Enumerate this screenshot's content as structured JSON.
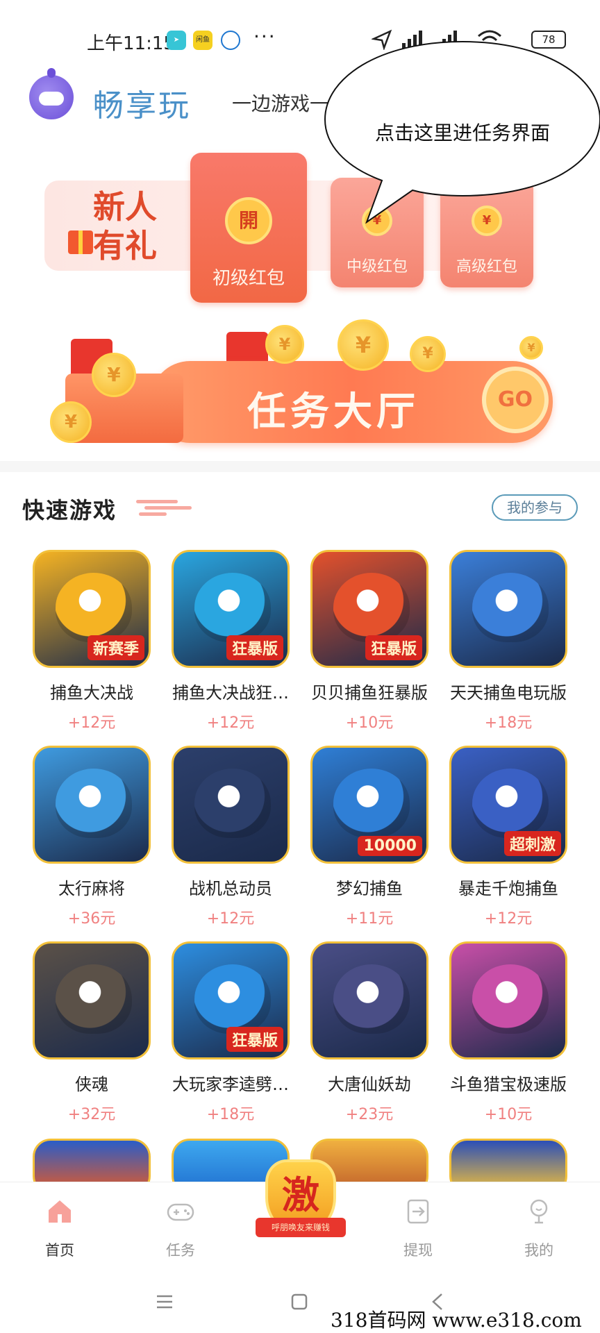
{
  "status_bar": {
    "time": "上午11:15",
    "app_badge_2": "闲鱼",
    "more": "···",
    "battery": "78"
  },
  "header": {
    "app_name": "畅享玩",
    "slogan": "一边游戏一"
  },
  "bubble": {
    "text": "点击这里进任务界面"
  },
  "new_user": {
    "title": "新人有礼",
    "packets": [
      {
        "label": "初级红包",
        "coin": "開"
      },
      {
        "label": "中级红包",
        "coin": "¥"
      },
      {
        "label": "高级红包",
        "coin": "¥"
      }
    ]
  },
  "task_hall": {
    "title": "任务大厅",
    "go": "GO"
  },
  "quick_games": {
    "title": "快速游戏",
    "my_participation": "我的参与",
    "games": [
      {
        "name": "捕鱼大决战",
        "reward": "+12元",
        "tag": "新赛季",
        "color": "#f5b323"
      },
      {
        "name": "捕鱼大决战狂…",
        "reward": "+12元",
        "tag": "狂暴版",
        "color": "#2aa6e0"
      },
      {
        "name": "贝贝捕鱼狂暴版",
        "reward": "+10元",
        "tag": "狂暴版",
        "color": "#e4512c"
      },
      {
        "name": "天天捕鱼电玩版",
        "reward": "+18元",
        "tag": "",
        "color": "#3b7fd9"
      },
      {
        "name": "太行麻将",
        "reward": "+36元",
        "tag": "",
        "color": "#3f9be0"
      },
      {
        "name": "战机总动员",
        "reward": "+12元",
        "tag": "",
        "color": "#2c3f6b"
      },
      {
        "name": "梦幻捕鱼",
        "reward": "+11元",
        "tag": "10000",
        "color": "#2f7fd6"
      },
      {
        "name": "暴走千炮捕鱼",
        "reward": "+12元",
        "tag": "超刺激",
        "color": "#3a60c4"
      },
      {
        "name": "侠魂",
        "reward": "+32元",
        "tag": "",
        "color": "#5b5148"
      },
      {
        "name": "大玩家李逵劈…",
        "reward": "+18元",
        "tag": "狂暴版",
        "color": "#2d8ee0"
      },
      {
        "name": "大唐仙妖劫",
        "reward": "+23元",
        "tag": "",
        "color": "#4a4e86"
      },
      {
        "name": "斗鱼猎宝极速版",
        "reward": "+10元",
        "tag": "",
        "color": "#c94fa8"
      }
    ]
  },
  "bottom_nav": {
    "items": [
      {
        "label": "首页"
      },
      {
        "label": "任务"
      },
      {
        "label": "提现"
      },
      {
        "label": "我的"
      }
    ],
    "boost_text": "激",
    "boost_ribbon": "呼朋唤友来赚钱"
  },
  "watermark": "318首码网  www.e318.com"
}
